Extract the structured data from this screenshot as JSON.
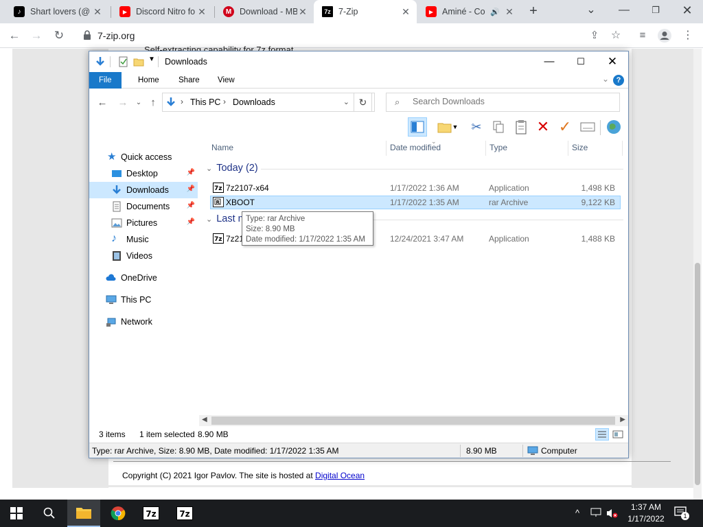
{
  "browser": {
    "tabs": [
      {
        "title": "Shart lovers (@",
        "icon": "tiktok-icon"
      },
      {
        "title": "Discord Nitro fo",
        "icon": "youtube-icon"
      },
      {
        "title": "Download - MB",
        "icon": "mb-icon"
      },
      {
        "title": "7-Zip",
        "icon": "7zip-icon",
        "active": true
      },
      {
        "title": "Aminé - Co",
        "icon": "youtube-icon",
        "audio": true
      }
    ],
    "url": "7-zip.org"
  },
  "webpage": {
    "peek_text": "Self-extracting capability for 7z format",
    "copyright": "Copyright (C) 2021 Igor Pavlov. The site is hosted at",
    "host_link": "Digital Ocean"
  },
  "explorer": {
    "title": "Downloads",
    "ribbon_tabs": [
      "File",
      "Home",
      "Share",
      "View"
    ],
    "breadcrumb": [
      "This PC",
      "Downloads"
    ],
    "search_placeholder": "Search Downloads",
    "nav": {
      "quick_access": "Quick access",
      "desktop": "Desktop",
      "downloads": "Downloads",
      "documents": "Documents",
      "pictures": "Pictures",
      "music": "Music",
      "videos": "Videos",
      "onedrive": "OneDrive",
      "thispc": "This PC",
      "network": "Network"
    },
    "columns": {
      "name": "Name",
      "date": "Date modified",
      "type": "Type",
      "size": "Size"
    },
    "groups": {
      "today": "Today (2)",
      "last_month": "Last month (1)"
    },
    "files": [
      {
        "name": "7z2107-x64",
        "date": "1/17/2022 1:36 AM",
        "type": "Application",
        "size": "1,498 KB"
      },
      {
        "name": "XBOOT",
        "date": "1/17/2022 1:35 AM",
        "type": "rar Archive",
        "size": "9,122 KB"
      },
      {
        "name": "7z2106-x64",
        "date": "12/24/2021 3:47 AM",
        "type": "Application",
        "size": "1,488 KB"
      }
    ],
    "tooltip": {
      "line1": "Type: rar Archive",
      "line2": "Size: 8.90 MB",
      "line3": "Date modified: 1/17/2022 1:35 AM"
    },
    "status": {
      "items": "3 items",
      "selected": "1 item selected",
      "selected_size": "8.90 MB"
    },
    "infobar": {
      "details": "Type: rar Archive, Size: 8.90 MB, Date modified: 1/17/2022 1:35 AM",
      "size": "8.90 MB",
      "location": "Computer"
    }
  },
  "taskbar": {
    "time": "1:37 AM",
    "date": "1/17/2022",
    "notifications": "1"
  }
}
